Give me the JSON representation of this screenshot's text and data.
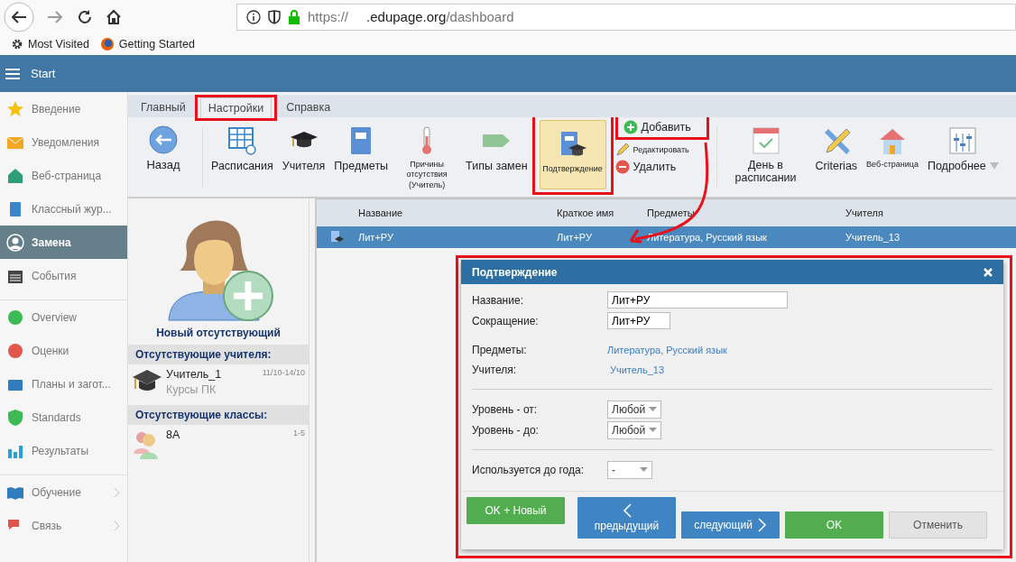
{
  "browser": {
    "url_scheme": "https://",
    "url_domain": ".edupage.org",
    "url_path": "/dashboard",
    "bookmarks": [
      "Most Visited",
      "Getting Started"
    ]
  },
  "header": {
    "title": "Start"
  },
  "sidebar": {
    "items": [
      {
        "label": "Введение",
        "selected": false,
        "group_start": false,
        "has_submenu": false
      },
      {
        "label": "Уведомления",
        "selected": false,
        "group_start": false,
        "has_submenu": false
      },
      {
        "label": "Веб-страница",
        "selected": false,
        "group_start": false,
        "has_submenu": false
      },
      {
        "label": "Классный жур...",
        "selected": false,
        "group_start": false,
        "has_submenu": false
      },
      {
        "label": "Замена",
        "selected": true,
        "group_start": false,
        "has_submenu": false
      },
      {
        "label": "События",
        "selected": false,
        "group_start": false,
        "has_submenu": false
      },
      {
        "label": "Overview",
        "selected": false,
        "group_start": true,
        "has_submenu": false
      },
      {
        "label": "Оценки",
        "selected": false,
        "group_start": false,
        "has_submenu": false
      },
      {
        "label": "Планы и загот...",
        "selected": false,
        "group_start": false,
        "has_submenu": false
      },
      {
        "label": "Standards",
        "selected": false,
        "group_start": false,
        "has_submenu": false
      },
      {
        "label": "Результаты",
        "selected": false,
        "group_start": false,
        "has_submenu": false
      },
      {
        "label": "Обучение",
        "selected": false,
        "group_start": true,
        "has_submenu": true
      },
      {
        "label": "Связь",
        "selected": false,
        "group_start": false,
        "has_submenu": true
      }
    ]
  },
  "tabs": [
    {
      "label": "Главный",
      "selected": false
    },
    {
      "label": "Настройки",
      "selected": true
    },
    {
      "label": "Справка",
      "selected": false
    }
  ],
  "ribbon": {
    "back": {
      "label": "Назад"
    },
    "items": [
      {
        "label": "Расписания",
        "compact": false,
        "selected": false
      },
      {
        "label": "Учителя",
        "compact": false,
        "selected": false
      },
      {
        "label": "Предметы",
        "compact": false,
        "selected": false
      },
      {
        "label": "Причины отсутствия (Учитель)",
        "compact": true,
        "selected": false
      },
      {
        "label": "Типы замен",
        "compact": false,
        "selected": false
      },
      {
        "label": "Подтверждение",
        "compact": true,
        "selected": true
      }
    ],
    "actions": [
      {
        "label": "Добавить",
        "compact": false
      },
      {
        "label": "Редактировать",
        "compact": true
      },
      {
        "label": "Удалить",
        "compact": false
      }
    ],
    "items2": [
      {
        "label": "День в расписании",
        "compact": false
      },
      {
        "label": "Criterias",
        "compact": false
      },
      {
        "label": "Веб-страница",
        "compact": true
      }
    ],
    "more": {
      "label": "Подробнее"
    }
  },
  "absence": {
    "new_label": "Новый отсутствующий",
    "sections": [
      {
        "title": "Отсутствующие учителя:",
        "entries": [
          {
            "name": "Учитель_1",
            "note": "Курсы ПК",
            "dates": "11/10-14/10"
          }
        ]
      },
      {
        "title": "Отсутствующие классы:",
        "entries": [
          {
            "name": "8A",
            "dates": "1-5"
          }
        ]
      }
    ]
  },
  "table": {
    "columns": [
      "Название",
      "Краткое имя",
      "Предметы",
      "Учителя"
    ],
    "rows": [
      {
        "cells": [
          "Лит+РУ",
          "Лит+РУ",
          "Литература, Русский язык",
          "Учитель_13"
        ],
        "selected": true
      }
    ]
  },
  "dialog": {
    "title": "Подтверждение",
    "inputs": [
      {
        "label": "Название:",
        "value": "Лит+РУ",
        "wide": true
      },
      {
        "label": "Сокращение:",
        "value": "Лит+РУ",
        "wide": false
      }
    ],
    "links": [
      {
        "label": "Предметы:",
        "value": "Литература, Русский язык"
      },
      {
        "label": "Учителя:",
        "value": "Учитель_13"
      }
    ],
    "levels": [
      {
        "label": "Уровень - от:",
        "value": "Любой"
      },
      {
        "label": "Уровень - до:",
        "value": "Любой"
      }
    ],
    "year": {
      "label": "Используется до года:",
      "value": "-"
    },
    "buttons": [
      {
        "label": "OK + Новый",
        "kind": "green"
      },
      {
        "label": "предыдущий",
        "kind": "prev"
      },
      {
        "label": "следующий",
        "kind": "next"
      },
      {
        "label": "OK",
        "kind": "green"
      },
      {
        "label": "Отменить",
        "kind": "grey"
      }
    ]
  }
}
